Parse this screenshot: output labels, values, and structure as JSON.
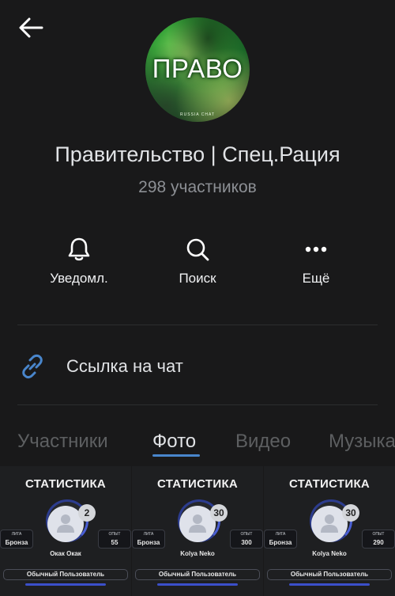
{
  "chat": {
    "avatar_text": "ПРАВО",
    "avatar_subtext": "RUSSIA CHAT",
    "title": "Правительство | Спец.Рация",
    "members": "298 участников"
  },
  "actions": [
    {
      "label": "Уведомл.",
      "icon": "bell-icon"
    },
    {
      "label": "Поиск",
      "icon": "search-icon"
    },
    {
      "label": "Ещё",
      "icon": "more-icon"
    }
  ],
  "chat_link": {
    "label": "Ссылка на чат",
    "icon": "link-icon"
  },
  "tabs": [
    {
      "label": "Участники",
      "active": false
    },
    {
      "label": "Фото",
      "active": true
    },
    {
      "label": "Видео",
      "active": false
    },
    {
      "label": "Музыка",
      "active": false
    }
  ],
  "photos": [
    {
      "title": "СТАТИСТИКА",
      "badge": "2",
      "league_label": "ЛИГА",
      "league": "Бронза",
      "exp_label": "ОПЫТ",
      "exp": "55",
      "name": "Окак Окак",
      "status": "Обычный Пользователь"
    },
    {
      "title": "СТАТИСТИКА",
      "badge": "30",
      "league_label": "ЛИГА",
      "league": "Бронза",
      "exp_label": "ОПЫТ",
      "exp": "300",
      "name": "Kolya Neko",
      "status": "Обычный Пользователь"
    },
    {
      "title": "СТАТИСТИКА",
      "badge": "30",
      "league_label": "ЛИГА",
      "league": "Бронза",
      "exp_label": "ОПЫТ",
      "exp": "290",
      "name": "Kolya Neko",
      "status": "Обычный Пользователь"
    }
  ],
  "colors": {
    "background": "#19191a",
    "accent": "#4986cc",
    "text": "#e1e3e6",
    "secondary": "#8c8f94"
  }
}
